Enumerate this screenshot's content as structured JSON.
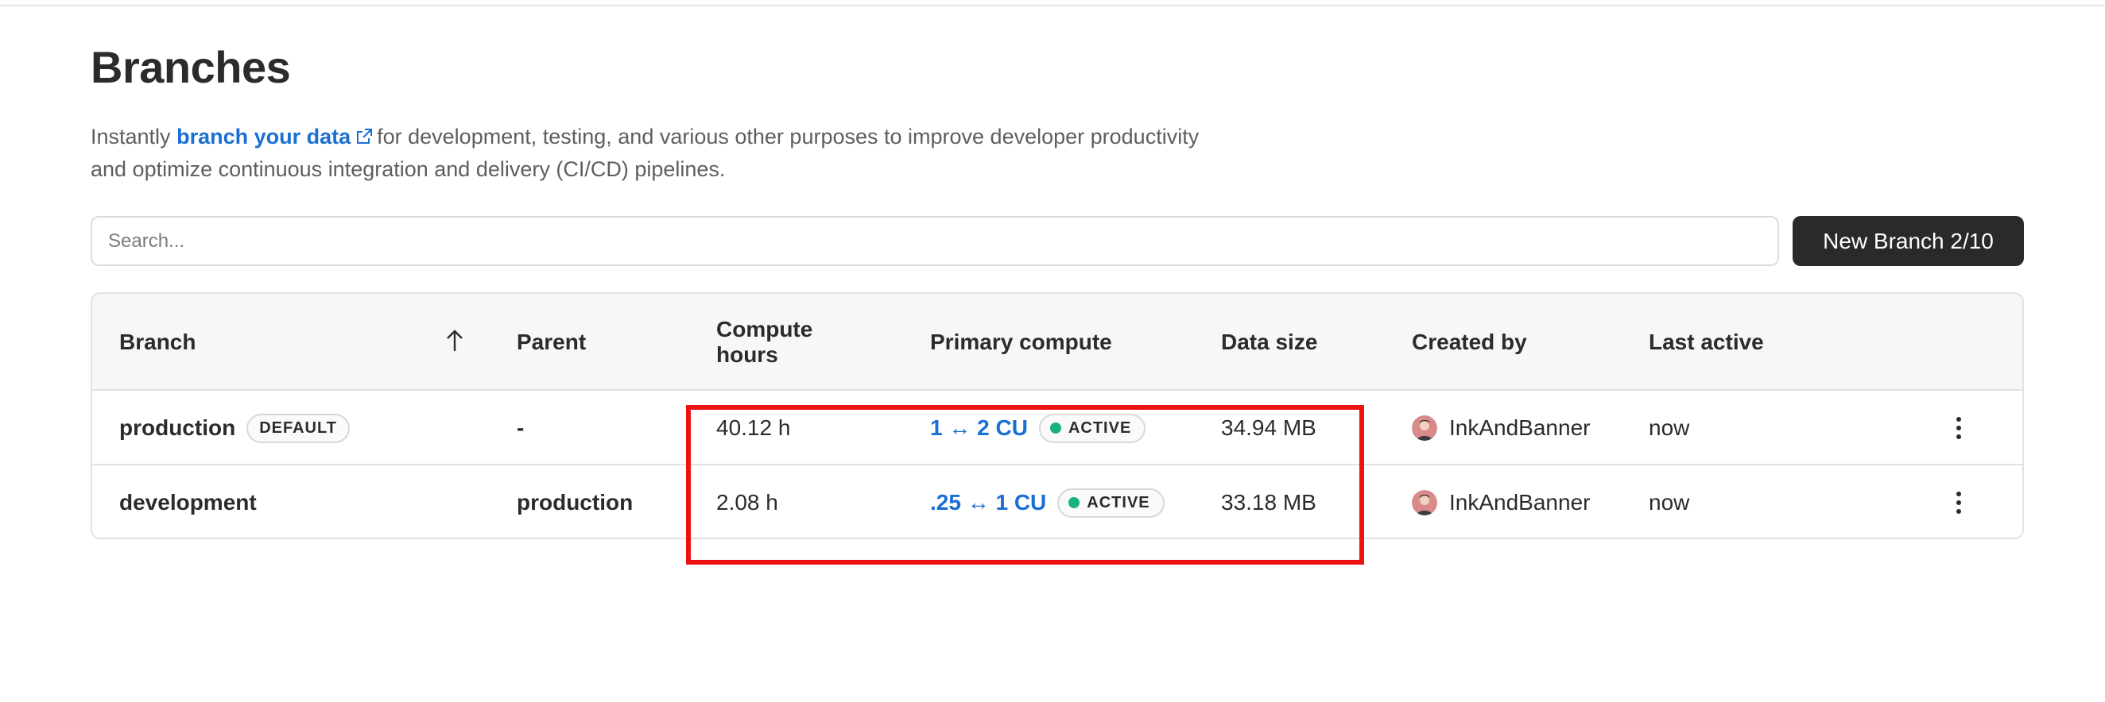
{
  "page": {
    "title": "Branches",
    "intro_prefix": "Instantly",
    "intro_link": "branch your data",
    "intro_suffix": "for development, testing, and various other purposes to improve developer productivity",
    "intro_line2": "and optimize continuous integration and delivery (CI/CD) pipelines."
  },
  "search": {
    "placeholder": "Search...",
    "value": ""
  },
  "new_branch_button": "New Branch 2/10",
  "table": {
    "headers": {
      "branch": "Branch",
      "parent": "Parent",
      "compute_hours_line1": "Compute",
      "compute_hours_line2": "hours",
      "primary_compute": "Primary compute",
      "data_size": "Data size",
      "created_by": "Created by",
      "last_active": "Last active"
    },
    "sort": {
      "column": "Branch",
      "direction": "ascending",
      "icon": "arrow-up-icon"
    },
    "rows": [
      {
        "branch": "production",
        "badge": "DEFAULT",
        "parent": "-",
        "compute_hours": "40.12 h",
        "primary_compute": "1 ↔ 2 CU",
        "status": "ACTIVE",
        "data_size": "34.94 MB",
        "created_by": "InkAndBanner",
        "last_active": "now"
      },
      {
        "branch": "development",
        "badge": "",
        "parent": "production",
        "compute_hours": "2.08 h",
        "primary_compute": ".25 ↔ 1 CU",
        "status": "ACTIVE",
        "data_size": "33.18 MB",
        "created_by": "InkAndBanner",
        "last_active": "now"
      }
    ]
  },
  "colors": {
    "link": "#1a6fd4",
    "active_dot": "#19b37a",
    "button_bg": "#2a2a2a",
    "annotation_box": "#ee1111"
  },
  "icons": [
    "external-link-icon",
    "arrow-up-icon",
    "avatar",
    "kebab-menu-icon",
    "status-dot"
  ]
}
